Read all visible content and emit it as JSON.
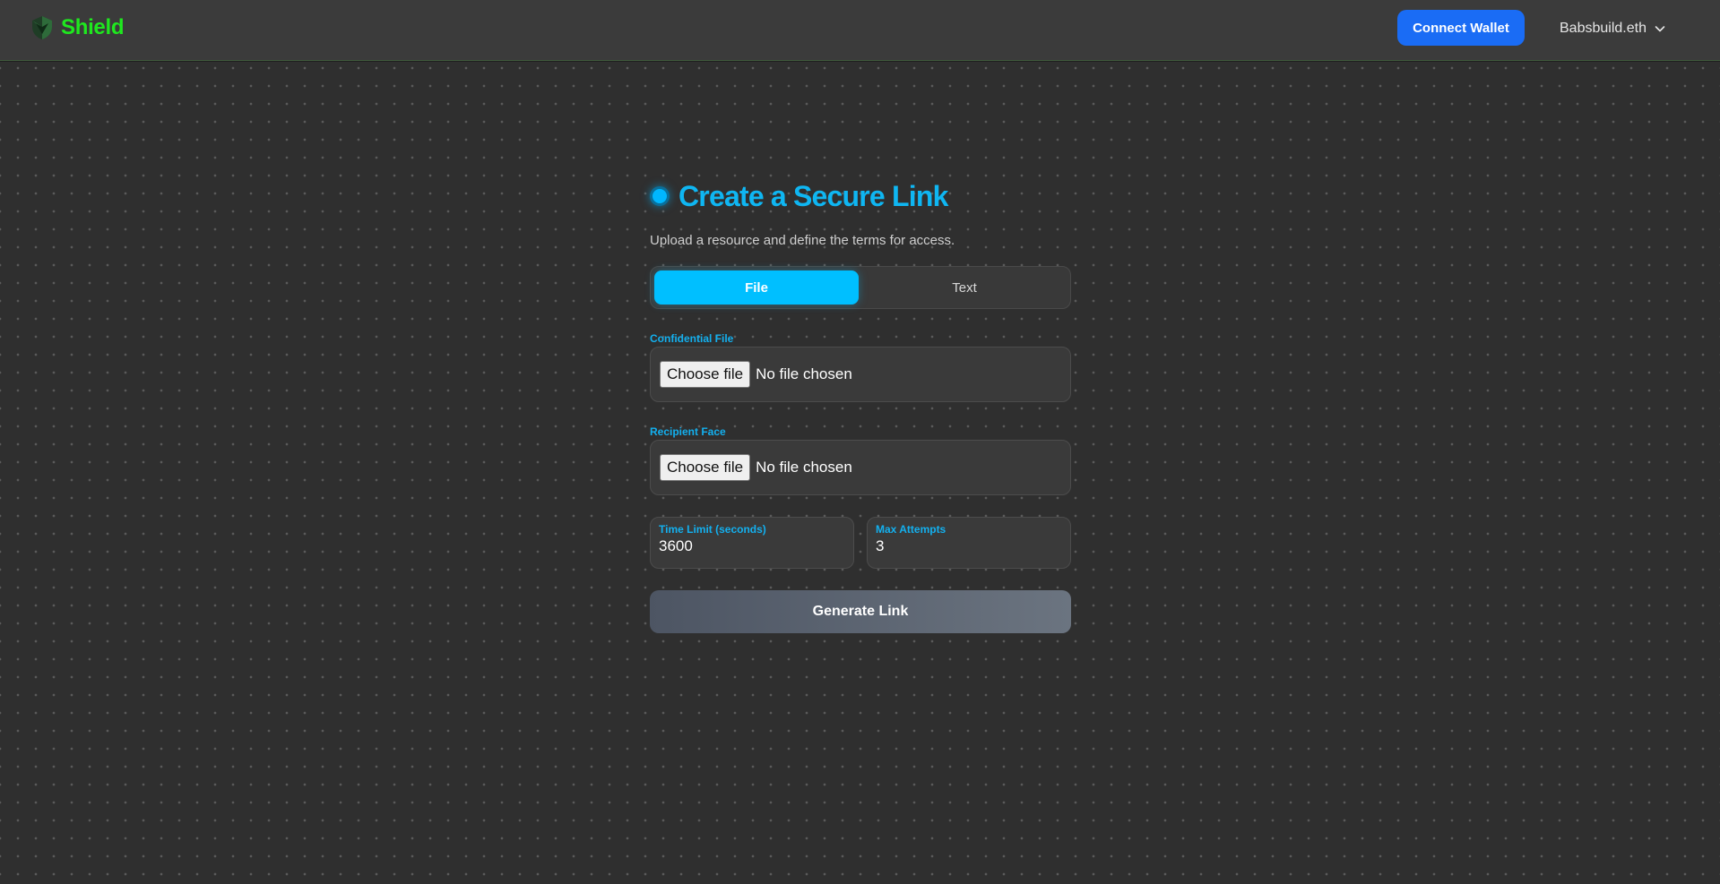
{
  "header": {
    "brand_name": "Shield",
    "brand_color": "#1fe81f",
    "connect_label": "Connect Wallet",
    "account_name": "Babsbuild.eth"
  },
  "form": {
    "title": "Create a Secure Link",
    "subtitle": "Upload a resource and define the terms for access.",
    "accent_color": "#00bfff",
    "tabs": [
      {
        "label": "File",
        "active": true
      },
      {
        "label": "Text",
        "active": false
      }
    ],
    "confidential_file": {
      "label": "Confidential File",
      "button_label": "Choose file",
      "status": "No file chosen"
    },
    "recipient_face": {
      "label": "Recipient Face",
      "button_label": "Choose file",
      "status": "No file chosen"
    },
    "time_limit": {
      "label": "Time Limit (seconds)",
      "value": "3600"
    },
    "max_attempts": {
      "label": "Max Attempts",
      "value": "3"
    },
    "generate_label": "Generate Link"
  }
}
